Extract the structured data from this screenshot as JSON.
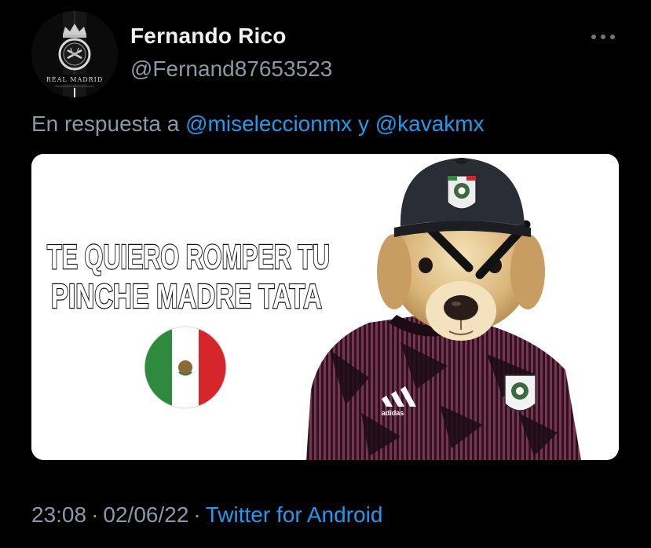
{
  "user": {
    "display_name": "Fernando Rico",
    "handle": "@Fernand87653523",
    "avatar_text": "REAL MADRID"
  },
  "reply": {
    "prefix": "En respuesta a",
    "mentions": [
      "@miseleccionmx",
      "@kavakmx"
    ],
    "joiner": "y"
  },
  "media": {
    "caption_line1": "TE QUIERO ROMPER TU",
    "caption_line2": "PINCHE MADRE TATA",
    "jersey_brand": "adidas"
  },
  "meta": {
    "time": "23:08",
    "date": "02/06/22",
    "separator": "·",
    "source": "Twitter for Android"
  },
  "icons": {
    "more": "more-horizontal-icon"
  },
  "colors": {
    "background": "#000000",
    "text": "#e7e9ea",
    "secondary": "#8b98a5",
    "link": "#1d9bf0"
  }
}
